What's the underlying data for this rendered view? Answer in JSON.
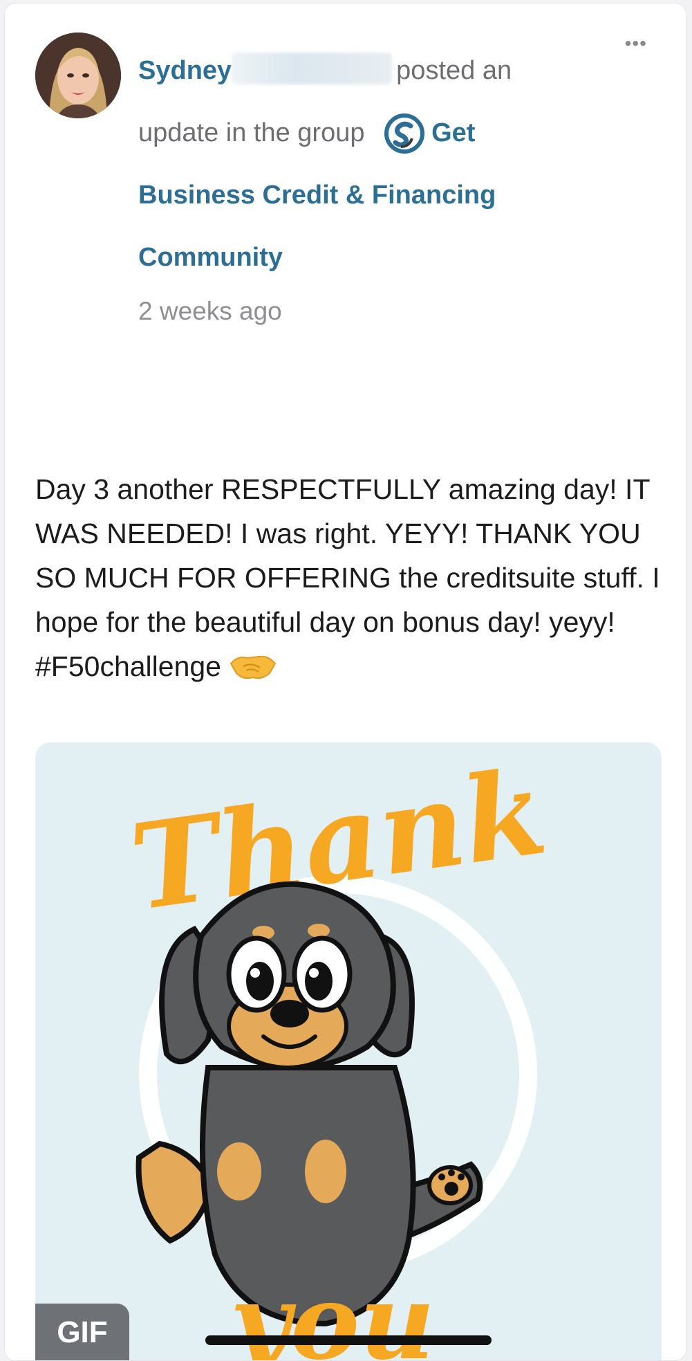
{
  "post": {
    "author_name": "Sydney",
    "action_text": "posted an update in the group",
    "group_name": "Get Business Credit & Financing Community",
    "timestamp": "2 weeks ago",
    "more_icon": "more-horizontal-icon",
    "body_text": "Day 3 another RESPECTFULLY amazing day! IT WAS NEEDED! I was right. YEYY! THANK YOU SO MUCH FOR OFFERING the creditsuite stuff. I hope for the beautiful day on bonus day! yeyy! #F50challenge",
    "emoji_name": "handshake-icon",
    "media": {
      "badge_label": "GIF",
      "top_text": "Thank",
      "bottom_text": "you"
    }
  },
  "colors": {
    "link": "#2d6e94",
    "muted": "#6d6d72",
    "gif_background": "#e2eff3",
    "lettering": "#f7a823"
  }
}
